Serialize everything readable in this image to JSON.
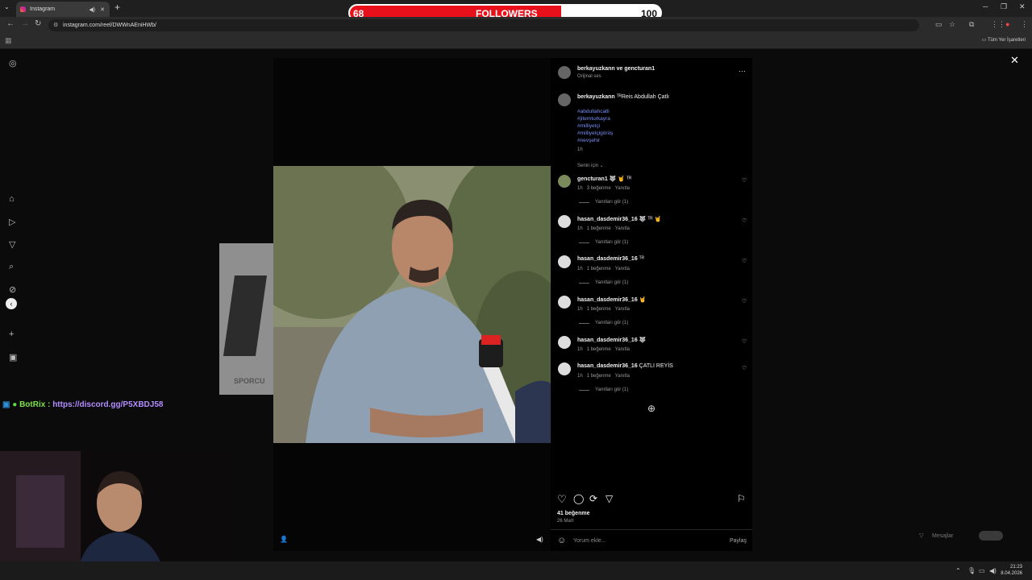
{
  "browser": {
    "tab_title": "Instagram",
    "url": "instagram.com/reel/DWWnAEniHWb/",
    "bookmarks_all": "Tüm Yer İşaretleri"
  },
  "followers_overlay": {
    "current": "68",
    "label": "FOLLOWERS",
    "goal": "100",
    "progress": 0.68
  },
  "post": {
    "header_user": "berkayuzkann ve gencturan1",
    "header_sub": "Orijinal ses",
    "caption_user": "berkayuzkann",
    "caption_text": "ᵀᴿReis Abdullah Çatlı",
    "hashtags": [
      "#abdullahcatli",
      "#jitemturkayra",
      "#milliyetçi",
      "#milliyetçigörüş",
      "#nevşehir"
    ],
    "caption_time": "1h",
    "sort_label": "Senin için",
    "likes": "41 beğenme",
    "date": "26 Mart",
    "comment_placeholder": "Yorum ekle...",
    "share_label": "Paylaş"
  },
  "comments": [
    {
      "user": "gencturan1",
      "text": "🐺 🤘 ᵀᴿ",
      "time": "1h",
      "likes": "3 beğenme",
      "reply": "Yanıtla",
      "view_replies": "Yanıtları gör (1)"
    },
    {
      "user": "hasan_dasdemir36_16",
      "text": "🐺 ᵀᴿ 🤘",
      "time": "1h",
      "likes": "1 beğenme",
      "reply": "Yanıtla",
      "view_replies": "Yanıtları gör (1)"
    },
    {
      "user": "hasan_dasdemir36_16",
      "text": "ᵀᴿ",
      "time": "1h",
      "likes": "1 beğenme",
      "reply": "Yanıtla",
      "view_replies": "Yanıtları gör (1)"
    },
    {
      "user": "hasan_dasdemir36_16",
      "text": "🤘",
      "time": "1h",
      "likes": "1 beğenme",
      "reply": "Yanıtla",
      "view_replies": "Yanıtları gör (1)"
    },
    {
      "user": "hasan_dasdemir36_16",
      "text": "🐺",
      "time": "1h",
      "likes": "1 beğenme",
      "reply": "Yanıtla",
      "view_replies": ""
    },
    {
      "user": "hasan_dasdemir36_16",
      "text": "ÇATLI REYİS",
      "time": "1h",
      "likes": "1 beğenme",
      "reply": "Yanıtla",
      "view_replies": "Yanıtları gör (1)"
    }
  ],
  "stream": {
    "bot_name": "BotRix",
    "bot_sep": ":",
    "bot_link": "https://discord.gg/P5XBDJ58",
    "prev_thumb_text": "SPORCU"
  },
  "messages_widget": "Mesajlar",
  "taskbar": {
    "time": "21:23",
    "date": "8.04.2026"
  }
}
